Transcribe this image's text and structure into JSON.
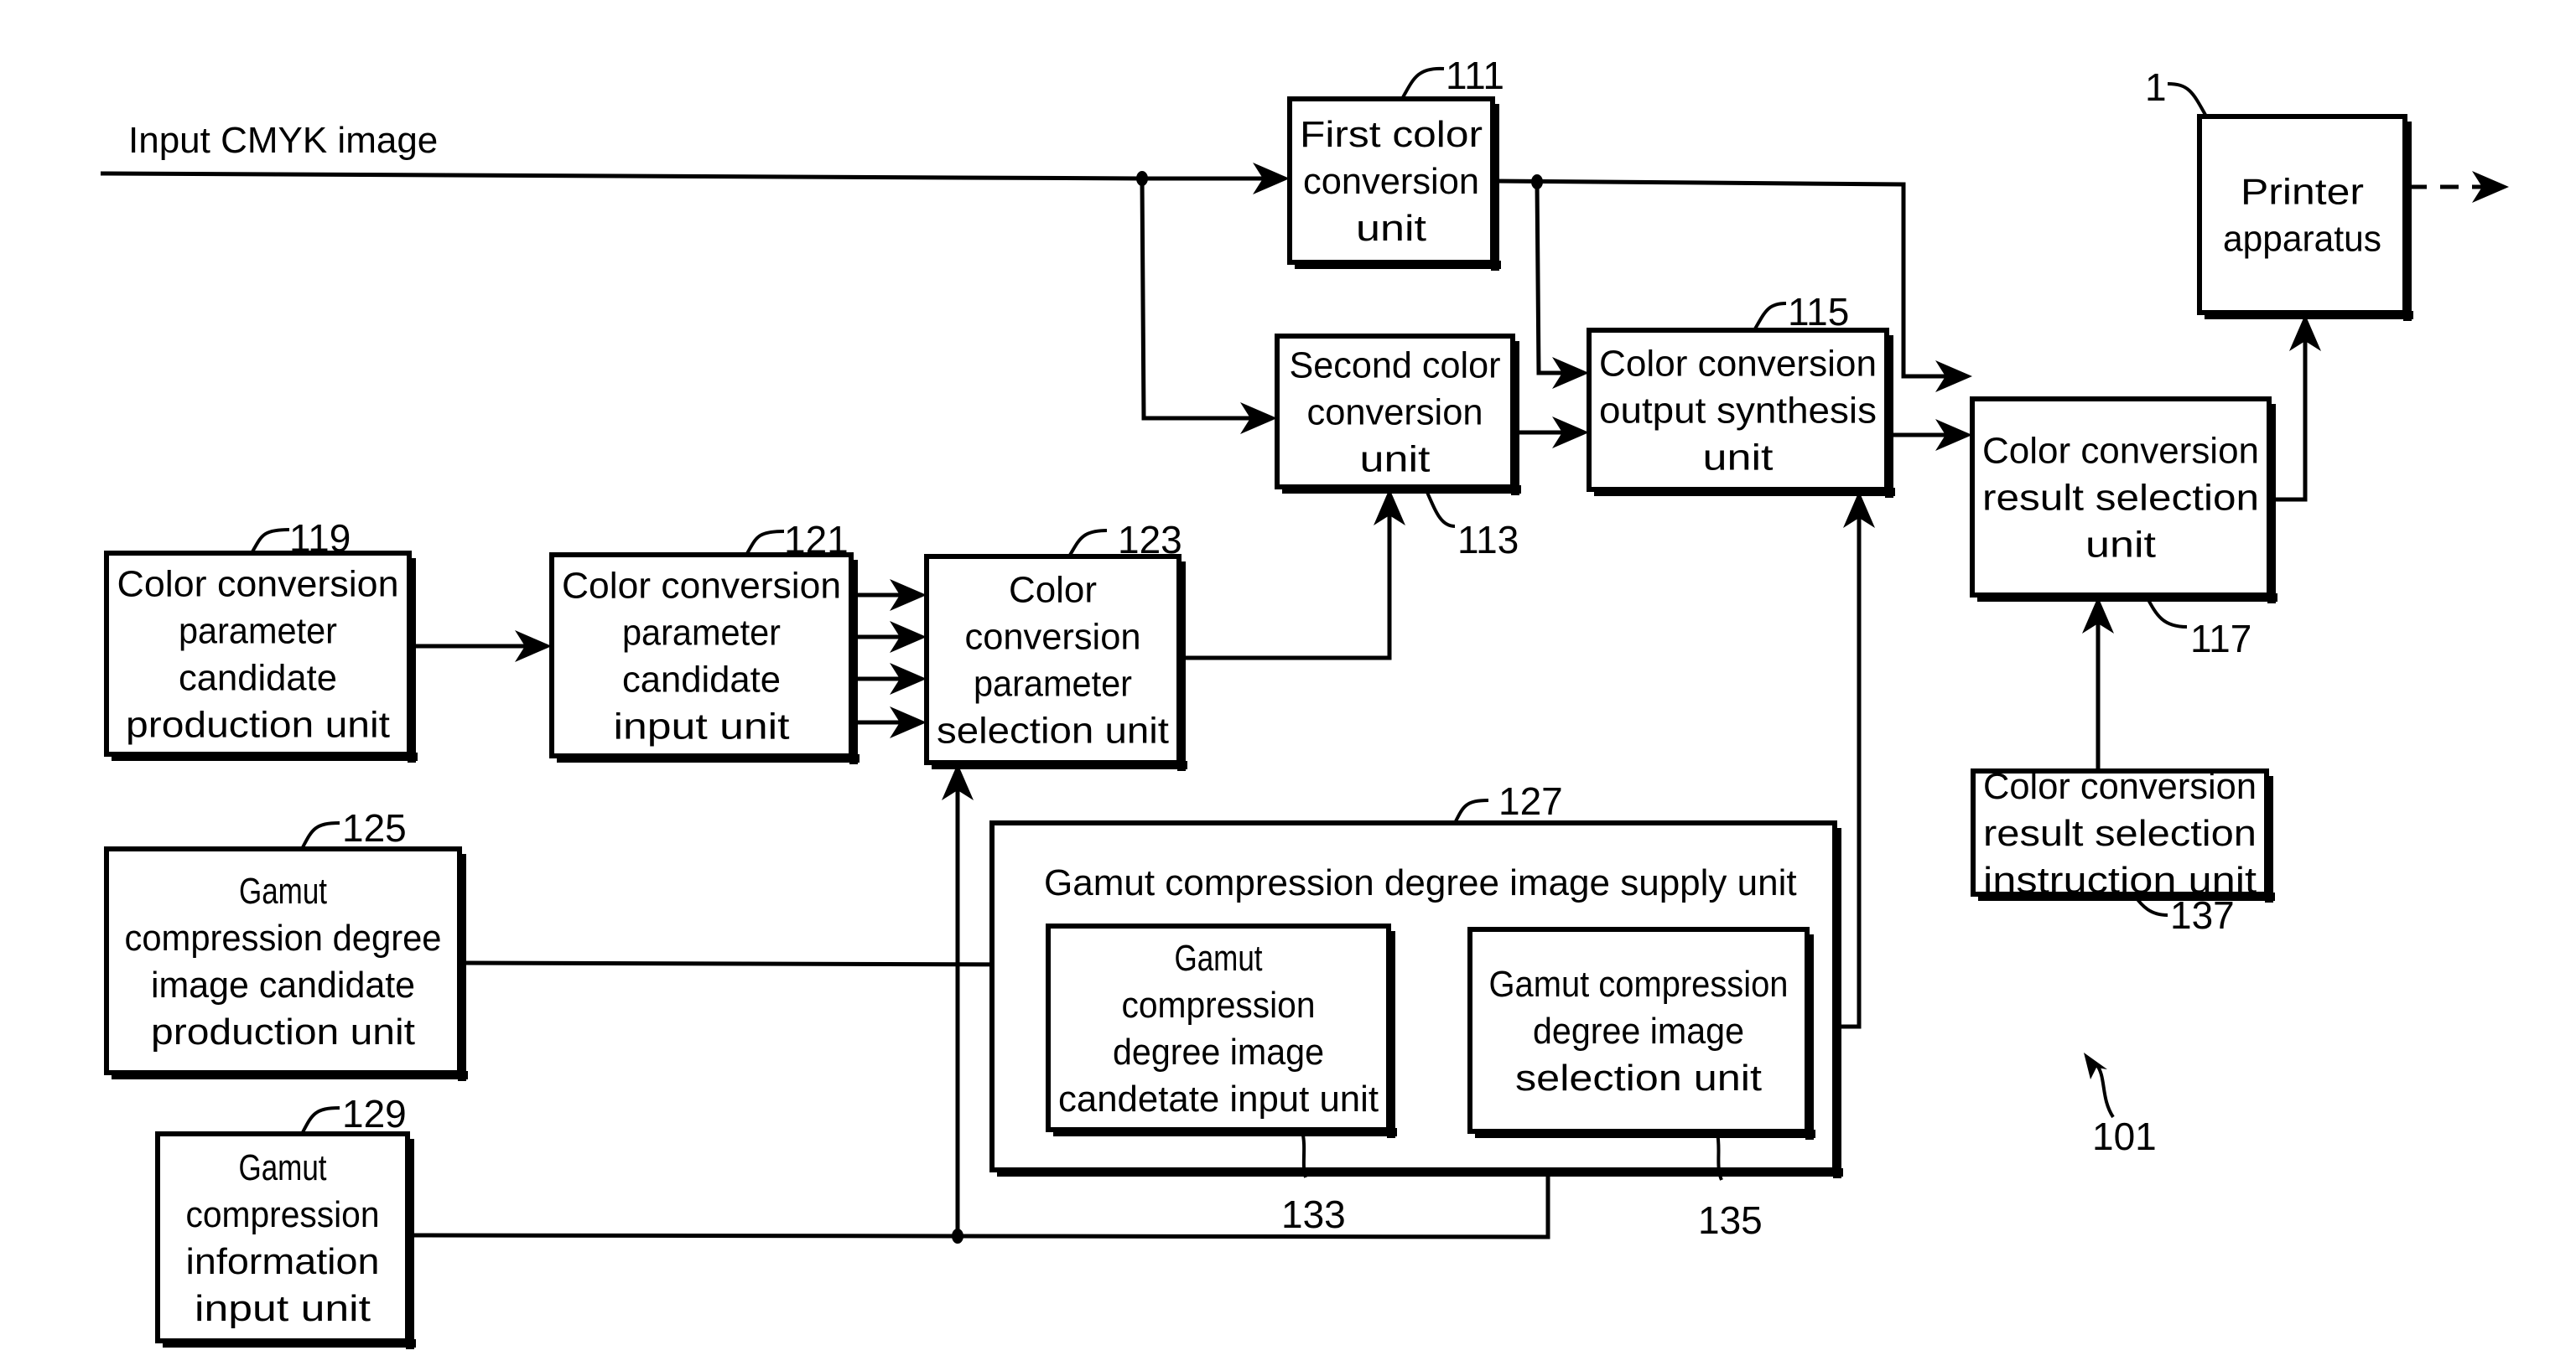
{
  "figure": {
    "input_label": "Input CMYK image",
    "system_ref": "101"
  },
  "blocks": {
    "first_conversion": {
      "ref": "111",
      "lines": [
        "First color",
        "conversion",
        "unit"
      ]
    },
    "second_conversion": {
      "ref": "113",
      "lines": [
        "Second color",
        "conversion",
        "unit"
      ]
    },
    "output_synthesis": {
      "ref": "115",
      "lines": [
        "Color conversion",
        "output synthesis",
        "unit"
      ]
    },
    "result_selection": {
      "ref": "117",
      "lines": [
        "Color conversion",
        "result selection",
        "unit"
      ]
    },
    "printer": {
      "ref": "1",
      "lines": [
        "Printer",
        "apparatus"
      ]
    },
    "param_candidate_production": {
      "ref": "119",
      "lines": [
        "Color conversion",
        "parameter",
        "candidate",
        "production unit"
      ]
    },
    "param_candidate_input": {
      "ref": "121",
      "lines": [
        "Color conversion",
        "parameter",
        "candidate",
        "input unit"
      ]
    },
    "param_selection": {
      "ref": "123",
      "lines": [
        "Color",
        "conversion",
        "parameter",
        "selection unit"
      ]
    },
    "gamut_candidate_production": {
      "ref": "125",
      "lines": [
        "Gamut",
        "compression degree",
        "image candidate",
        "production unit"
      ]
    },
    "gamut_supply": {
      "ref": "127",
      "title": "Gamut compression degree image supply unit"
    },
    "gamut_info_input": {
      "ref": "129",
      "lines": [
        "Gamut",
        "compression",
        "information",
        "input unit"
      ]
    },
    "gamut_candidate_input": {
      "ref": "133",
      "lines": [
        "Gamut",
        "compression",
        "degree image",
        "candetate input unit"
      ]
    },
    "gamut_selection": {
      "ref": "135",
      "lines": [
        "Gamut compression",
        "degree image",
        "selection unit"
      ]
    },
    "result_selection_instruction": {
      "ref": "137",
      "lines": [
        "Color conversion",
        "result selection",
        "instruction unit"
      ]
    }
  }
}
